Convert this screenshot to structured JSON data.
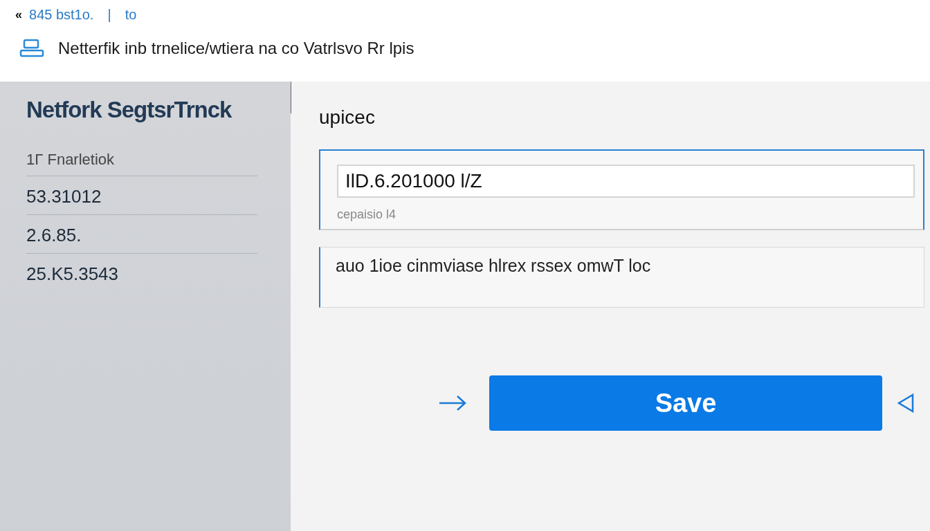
{
  "breadcrumb": {
    "back": "«",
    "path": "845 bst1o.",
    "separator": "|",
    "tail": "to"
  },
  "header": {
    "title": "Netterfik inb trnelice/wtiera na co Vatrlsvo Rr lpis"
  },
  "sidebar": {
    "title": "Netfork SegtsrTrnck",
    "subtitle": "1Γ Fnarletiok",
    "items": [
      "53.31012",
      "2.6.85.",
      "25.K5.3543"
    ]
  },
  "form": {
    "label": "upicec",
    "address": {
      "value": "IlD.6.201000 l/Z",
      "hint": "cepaisio l4"
    },
    "note": "auo 1ioe cinmviase hlrex rssex omwT loc"
  },
  "save_button": "Save"
}
